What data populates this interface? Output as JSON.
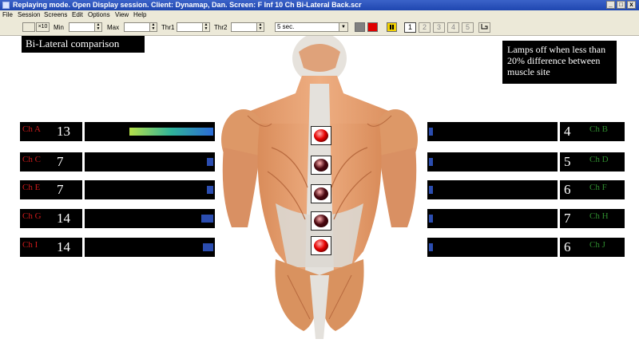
{
  "window": {
    "title": "Replaying mode. Open Display session. Client: Dynamap, Dan. Screen: F Inf 10 Ch Bi-Lateral Back.scr",
    "buttons": [
      "_",
      "□",
      "x"
    ]
  },
  "menu": [
    "File",
    "Session",
    "Screens",
    "Edit",
    "Options",
    "View",
    "Help"
  ],
  "toolbar": {
    "zoom_label": "×10",
    "min_label": "Min",
    "max_label": "Max",
    "thr1_label": "Thr1",
    "thr2_label": "Thr2",
    "interval": "5 sec.",
    "pages": [
      "1",
      "2",
      "3",
      "4",
      "5"
    ],
    "active_page": "1",
    "colors": {
      "gray_square": "#808080",
      "red_square": "#e00000",
      "pause_color": "#f2d200"
    }
  },
  "screen_title": "Bi-Lateral comparison",
  "note": "Lamps off when less than 20% difference between muscle site",
  "channels_left": [
    {
      "name": "Ch A",
      "value": "13",
      "level": 1.0,
      "fill": "gradient"
    },
    {
      "name": "Ch C",
      "value": "7",
      "level": 0.06,
      "fill": "solid"
    },
    {
      "name": "Ch E",
      "value": "7",
      "level": 0.05,
      "fill": "solid"
    },
    {
      "name": "Ch G",
      "value": "14",
      "level": 0.14,
      "fill": "solid"
    },
    {
      "name": "Ch I",
      "value": "14",
      "level": 0.12,
      "fill": "solid"
    }
  ],
  "channels_right": [
    {
      "name": "Ch B",
      "value": "4",
      "level": 0.05
    },
    {
      "name": "Ch D",
      "value": "5",
      "level": 0.05
    },
    {
      "name": "Ch F",
      "value": "6",
      "level": 0.05
    },
    {
      "name": "Ch H",
      "value": "7",
      "level": 0.05
    },
    {
      "name": "Ch J",
      "value": "6",
      "level": 0.05
    }
  ],
  "lamps": [
    {
      "state": "on"
    },
    {
      "state": "off"
    },
    {
      "state": "off"
    },
    {
      "state": "off"
    },
    {
      "state": "on"
    }
  ],
  "colors": {
    "left_name": "#cc1a1a",
    "right_name": "#2e8b2e",
    "bar_blue": "#2b4db0",
    "lamp_on": "#e60000",
    "lamp_off": "#4a0710"
  }
}
